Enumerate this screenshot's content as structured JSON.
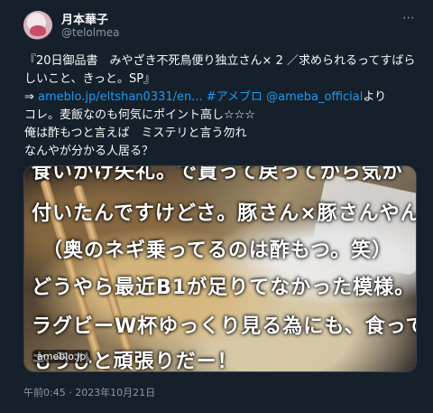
{
  "author": {
    "display_name": "月本華子",
    "handle": "@telolmea"
  },
  "more_icon": "⋯",
  "body": {
    "line1": "『20日御品書　みやざき不死鳥便り独立さん× 2 ／求められるってすばら",
    "line2": "しいこと、きっと。SP』",
    "line3_arrow": "⇒ ",
    "line3_link1": "ameblo.jp/eltshan0331/en...",
    "line3_tag": " #アメブロ",
    "line3_mention": " @ameba_official",
    "line3_tail": "より",
    "line4": "コレ。麦飯なのも何気にポイント高し☆☆☆",
    "line5": "俺は酢もつと言えば　ミステリと言う勿れ",
    "line6": "なんやが分かる人居る？"
  },
  "media": {
    "overlay_lines": [
      "食いかけ失礼。で貰って戻ってから気が",
      "付いたんですけどさ。豚さん×豚さんやん",
      "（奥のネギ乗ってるのは酢もつ。笑）",
      "どうやら最近B1が足りてなかった模様。",
      "ラグビーW杯ゆっくり見る為にも、食って",
      "もうひと頑張りだー！"
    ],
    "source_badge": "ameblo.jp"
  },
  "timestamp": "午前0:45 · 2023年10月21日"
}
